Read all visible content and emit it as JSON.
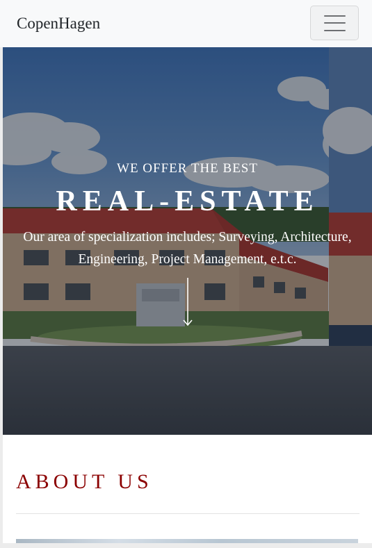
{
  "navbar": {
    "brand": "CopenHagen",
    "toggle_icon": "hamburger-menu-icon"
  },
  "hero": {
    "kicker": "WE OFFER THE BEST",
    "title": "REAL-ESTATE",
    "description": "Our area of specialization includes; Surveying, Architecture, Engineering, Project Management, e.t.c.",
    "scroll_icon": "arrow-down-icon"
  },
  "about": {
    "title": "ABOUT US"
  },
  "colors": {
    "navbar_bg": "#f8f9fa",
    "accent": "#8b0000",
    "hero_text": "#ffffff"
  }
}
